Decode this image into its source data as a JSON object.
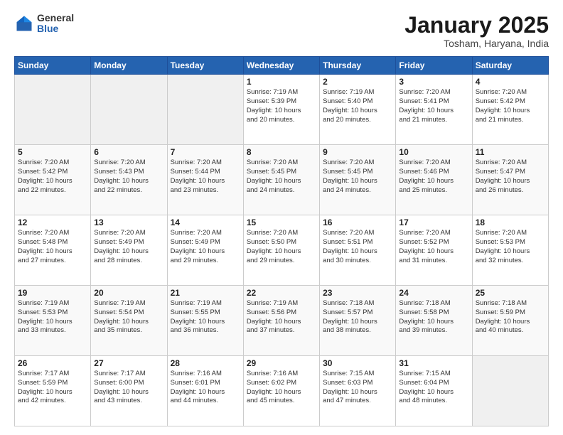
{
  "header": {
    "logo_line1": "General",
    "logo_line2": "Blue",
    "main_title": "January 2025",
    "sub_title": "Tosham, Haryana, India"
  },
  "days_of_week": [
    "Sunday",
    "Monday",
    "Tuesday",
    "Wednesday",
    "Thursday",
    "Friday",
    "Saturday"
  ],
  "weeks": [
    {
      "cells": [
        {
          "date": "",
          "info": ""
        },
        {
          "date": "",
          "info": ""
        },
        {
          "date": "",
          "info": ""
        },
        {
          "date": "1",
          "info": "Sunrise: 7:19 AM\nSunset: 5:39 PM\nDaylight: 10 hours\nand 20 minutes."
        },
        {
          "date": "2",
          "info": "Sunrise: 7:19 AM\nSunset: 5:40 PM\nDaylight: 10 hours\nand 20 minutes."
        },
        {
          "date": "3",
          "info": "Sunrise: 7:20 AM\nSunset: 5:41 PM\nDaylight: 10 hours\nand 21 minutes."
        },
        {
          "date": "4",
          "info": "Sunrise: 7:20 AM\nSunset: 5:42 PM\nDaylight: 10 hours\nand 21 minutes."
        }
      ]
    },
    {
      "cells": [
        {
          "date": "5",
          "info": "Sunrise: 7:20 AM\nSunset: 5:42 PM\nDaylight: 10 hours\nand 22 minutes."
        },
        {
          "date": "6",
          "info": "Sunrise: 7:20 AM\nSunset: 5:43 PM\nDaylight: 10 hours\nand 22 minutes."
        },
        {
          "date": "7",
          "info": "Sunrise: 7:20 AM\nSunset: 5:44 PM\nDaylight: 10 hours\nand 23 minutes."
        },
        {
          "date": "8",
          "info": "Sunrise: 7:20 AM\nSunset: 5:45 PM\nDaylight: 10 hours\nand 24 minutes."
        },
        {
          "date": "9",
          "info": "Sunrise: 7:20 AM\nSunset: 5:45 PM\nDaylight: 10 hours\nand 24 minutes."
        },
        {
          "date": "10",
          "info": "Sunrise: 7:20 AM\nSunset: 5:46 PM\nDaylight: 10 hours\nand 25 minutes."
        },
        {
          "date": "11",
          "info": "Sunrise: 7:20 AM\nSunset: 5:47 PM\nDaylight: 10 hours\nand 26 minutes."
        }
      ]
    },
    {
      "cells": [
        {
          "date": "12",
          "info": "Sunrise: 7:20 AM\nSunset: 5:48 PM\nDaylight: 10 hours\nand 27 minutes."
        },
        {
          "date": "13",
          "info": "Sunrise: 7:20 AM\nSunset: 5:49 PM\nDaylight: 10 hours\nand 28 minutes."
        },
        {
          "date": "14",
          "info": "Sunrise: 7:20 AM\nSunset: 5:49 PM\nDaylight: 10 hours\nand 29 minutes."
        },
        {
          "date": "15",
          "info": "Sunrise: 7:20 AM\nSunset: 5:50 PM\nDaylight: 10 hours\nand 29 minutes."
        },
        {
          "date": "16",
          "info": "Sunrise: 7:20 AM\nSunset: 5:51 PM\nDaylight: 10 hours\nand 30 minutes."
        },
        {
          "date": "17",
          "info": "Sunrise: 7:20 AM\nSunset: 5:52 PM\nDaylight: 10 hours\nand 31 minutes."
        },
        {
          "date": "18",
          "info": "Sunrise: 7:20 AM\nSunset: 5:53 PM\nDaylight: 10 hours\nand 32 minutes."
        }
      ]
    },
    {
      "cells": [
        {
          "date": "19",
          "info": "Sunrise: 7:19 AM\nSunset: 5:53 PM\nDaylight: 10 hours\nand 33 minutes."
        },
        {
          "date": "20",
          "info": "Sunrise: 7:19 AM\nSunset: 5:54 PM\nDaylight: 10 hours\nand 35 minutes."
        },
        {
          "date": "21",
          "info": "Sunrise: 7:19 AM\nSunset: 5:55 PM\nDaylight: 10 hours\nand 36 minutes."
        },
        {
          "date": "22",
          "info": "Sunrise: 7:19 AM\nSunset: 5:56 PM\nDaylight: 10 hours\nand 37 minutes."
        },
        {
          "date": "23",
          "info": "Sunrise: 7:18 AM\nSunset: 5:57 PM\nDaylight: 10 hours\nand 38 minutes."
        },
        {
          "date": "24",
          "info": "Sunrise: 7:18 AM\nSunset: 5:58 PM\nDaylight: 10 hours\nand 39 minutes."
        },
        {
          "date": "25",
          "info": "Sunrise: 7:18 AM\nSunset: 5:59 PM\nDaylight: 10 hours\nand 40 minutes."
        }
      ]
    },
    {
      "cells": [
        {
          "date": "26",
          "info": "Sunrise: 7:17 AM\nSunset: 5:59 PM\nDaylight: 10 hours\nand 42 minutes."
        },
        {
          "date": "27",
          "info": "Sunrise: 7:17 AM\nSunset: 6:00 PM\nDaylight: 10 hours\nand 43 minutes."
        },
        {
          "date": "28",
          "info": "Sunrise: 7:16 AM\nSunset: 6:01 PM\nDaylight: 10 hours\nand 44 minutes."
        },
        {
          "date": "29",
          "info": "Sunrise: 7:16 AM\nSunset: 6:02 PM\nDaylight: 10 hours\nand 45 minutes."
        },
        {
          "date": "30",
          "info": "Sunrise: 7:15 AM\nSunset: 6:03 PM\nDaylight: 10 hours\nand 47 minutes."
        },
        {
          "date": "31",
          "info": "Sunrise: 7:15 AM\nSunset: 6:04 PM\nDaylight: 10 hours\nand 48 minutes."
        },
        {
          "date": "",
          "info": ""
        }
      ]
    }
  ]
}
